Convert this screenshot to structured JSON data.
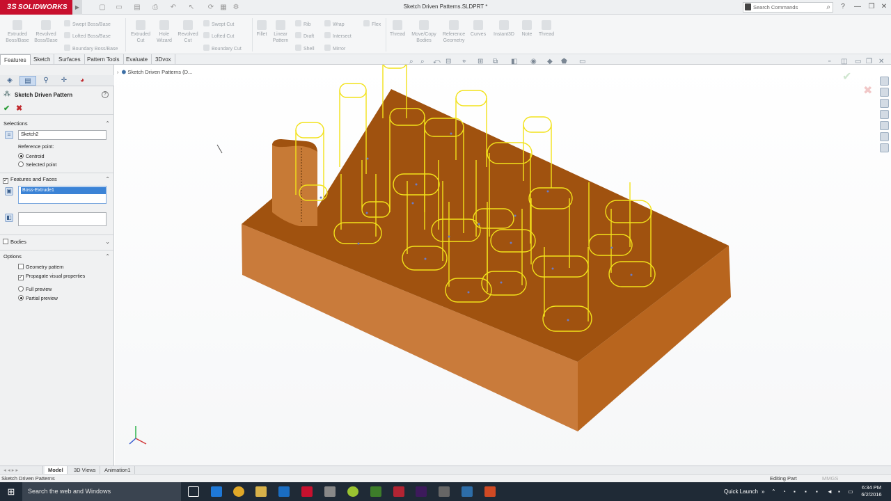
{
  "titlebar": {
    "logo": "SOLIDWORKS",
    "logo_mark": "3S",
    "document_title": "Sketch Driven Patterns.SLDPRT *",
    "search_placeholder": "Search Commands",
    "help": "?",
    "minimize": "—",
    "restore": "❐",
    "close": "✕"
  },
  "ribbon": {
    "big_buttons": [
      {
        "label": "Extruded\nBoss/Base"
      },
      {
        "label": "Revolved\nBoss/Base"
      },
      {
        "label": "Extruded\nCut"
      },
      {
        "label": "Hole\nWizard"
      },
      {
        "label": "Revolved\nCut"
      },
      {
        "label": "Fillet"
      },
      {
        "label": "Linear\nPattern"
      },
      {
        "label": "Thread"
      },
      {
        "label": "Move/Copy\nBodies"
      },
      {
        "label": "Reference\nGeometry"
      },
      {
        "label": "Curves"
      },
      {
        "label": "Instant3D"
      },
      {
        "label": "Note"
      },
      {
        "label": "Thread"
      }
    ],
    "small_buttons": [
      "Swept Boss/Base",
      "Lofted Boss/Base",
      "Boundary Boss/Base",
      "Swept Cut",
      "Lofted Cut",
      "Boundary Cut",
      "Rib",
      "Draft",
      "Shell",
      "Wrap",
      "Intersect",
      "Mirror",
      "Flex"
    ]
  },
  "command_tabs": [
    "Features",
    "Sketch",
    "Surfaces",
    "Pattern Tools",
    "Evaluate",
    "3Dvox"
  ],
  "property_manager": {
    "title": "Sketch Driven Pattern",
    "ok": "✔",
    "cancel": "✖",
    "selections_header": "Selections",
    "sketch_field": "Sketch2",
    "reference_point_label": "Reference point:",
    "ref_options": [
      {
        "label": "Centroid",
        "checked": true
      },
      {
        "label": "Selected point",
        "checked": false
      }
    ],
    "features_header": "Features and Faces",
    "features_selected": "Boss-Extrude1",
    "bodies_header": "Bodies",
    "options_header": "Options",
    "options": [
      {
        "label": "Geometry pattern",
        "checked": false
      },
      {
        "label": "Propagate visual properties",
        "checked": true
      }
    ],
    "preview_options": [
      {
        "label": "Full preview",
        "checked": false
      },
      {
        "label": "Partial preview",
        "checked": true
      }
    ]
  },
  "viewport": {
    "tree_root": "Sketch Driven Patterns (D...",
    "model_color": "#a0520f",
    "preview_color": "#f2e21a"
  },
  "bottom_tabs": [
    "Model",
    "3D Views",
    "Animation1"
  ],
  "status": {
    "left": "Sketch Driven Patterns",
    "right": "Editing Part",
    "units": "MMGS"
  },
  "taskbar": {
    "search": "Search the web and Windows",
    "quick_launch": "Quick Launch",
    "time": "6:34 PM",
    "date": "6/2/2016"
  }
}
